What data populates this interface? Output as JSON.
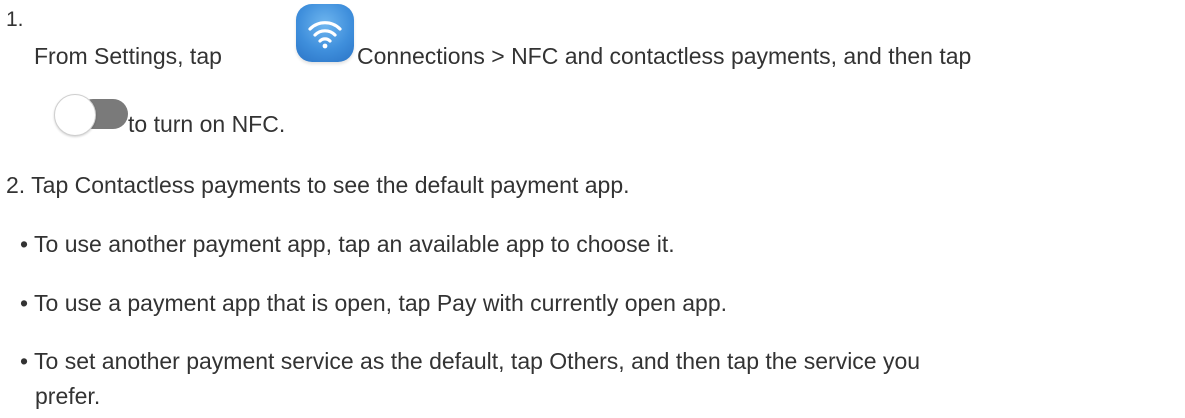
{
  "step1": {
    "number": "1.",
    "text_before_icon": "From Settings, tap",
    "icon_name": "settings-connections-wifi-icon",
    "icon_color": "#3f8fdc",
    "text_after_icon": "Connections > NFC and contactless payments, and then tap",
    "toggle_icon_name": "toggle-switch-icon",
    "toggle_color": "#7a7a7a",
    "text_after_toggle": "to turn on NFC."
  },
  "step2": {
    "text": "2. Tap Contactless payments to see the default payment app."
  },
  "bullets": [
    {
      "marker": "•",
      "text": "To use another payment app, tap an available app to choose it."
    },
    {
      "marker": "•",
      "text": "To use a payment app that is open, tap Pay with currently open app."
    },
    {
      "marker": "•",
      "text": "To set another payment service as the default, tap Others, and then tap the service you",
      "text_cont": "prefer."
    }
  ]
}
